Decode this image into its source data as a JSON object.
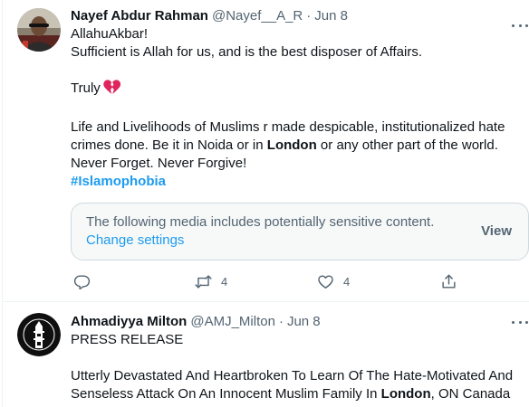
{
  "tweets": [
    {
      "name": "Nayef Abdur Rahman",
      "handle": "@Nayef__A_R",
      "separator": "·",
      "date": "Jun 8",
      "lines": {
        "l1": "AllahuAkbar!",
        "l2": "Sufficient is Allah for us, and is the best disposer of Affairs.",
        "l3": "Truly",
        "l4": "Life and Livelihoods of Muslims r made despicable, institutionalized hate",
        "l5a": "crimes done. Be it in Noida or in ",
        "l5b": "London",
        "l5c": " or any other part of the world.",
        "l6": "Never Forget. Never Forgive!",
        "l7": "#Islamophobia"
      },
      "emoji_icon": "broken-heart-icon",
      "sensitive": {
        "message": "The following media includes potentially sensitive content.",
        "link": "Change settings",
        "view": "View"
      },
      "actions": {
        "reply_count": "",
        "retweet_count": "4",
        "like_count": "4"
      }
    },
    {
      "name": "Ahmadiyya Milton",
      "handle": "@AMJ_Milton",
      "separator": "·",
      "date": "Jun 8",
      "lines": {
        "l1": "PRESS RELEASE",
        "l2": "Utterly Devastated And Heartbroken To Learn Of The Hate-Motivated And",
        "l3a": "Senseless Attack On An Innocent Muslim Family In ",
        "l3b": "London",
        "l3c": ", ON Canada"
      }
    }
  ],
  "icons": {
    "reply": "reply-icon",
    "retweet": "retweet-icon",
    "like": "like-icon",
    "share": "share-icon",
    "more": "more-icon"
  },
  "colors": {
    "accent": "#1d9bf0",
    "muted": "#536471",
    "text": "#0f1419",
    "border": "#eff3f4",
    "broken_heart": "#e0245e"
  }
}
